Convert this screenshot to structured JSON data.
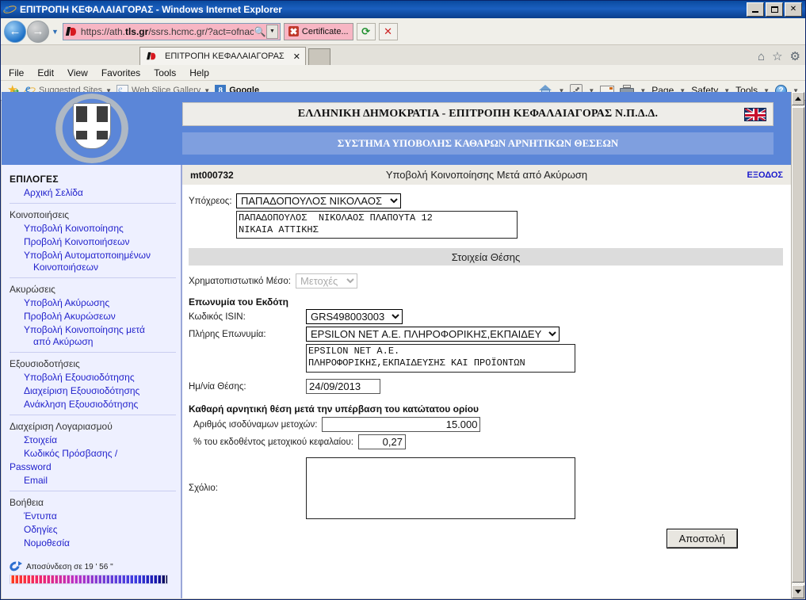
{
  "window": {
    "title": "ΕΠΙΤΡΟΠΗ ΚΕΦΑΛΑΙΑΓΟΡΑΣ - Windows Internet Explorer",
    "minimize_label": "_",
    "maximize_label": "□",
    "close_label": "✕"
  },
  "address_bar": {
    "url_prefix": "https://ath.",
    "url_domain": "tls.gr",
    "url_suffix": "/ssrs.hcmc.gr/?act=ofnac",
    "search_icon": "magnifier-icon",
    "dropdown_icon": "chevron-down-icon",
    "certificate_label": "Certificate...",
    "refresh_icon": "refresh-icon",
    "stop_icon": "stop-icon",
    "back_icon": "back-arrow-icon",
    "forward_icon": "forward-arrow-icon"
  },
  "tabs": [
    {
      "label": "ΕΠΙΤΡΟΠΗ ΚΕΦΑΛΑΙΑΓΟΡΑΣ",
      "close_label": "✕"
    }
  ],
  "tab_right_icons": [
    "home-icon",
    "favorites-star-icon",
    "tools-gear-icon"
  ],
  "menu": [
    {
      "label": "File",
      "accel": "F"
    },
    {
      "label": "Edit",
      "accel": "E"
    },
    {
      "label": "View",
      "accel": "V"
    },
    {
      "label": "Favorites",
      "accel": "a"
    },
    {
      "label": "Tools",
      "accel": "T"
    },
    {
      "label": "Help",
      "accel": "H"
    }
  ],
  "favorites_bar": {
    "add_icon": "add-to-favorites-icon",
    "items": [
      {
        "label": "Suggested Sites",
        "icon": "ie-icon",
        "has_caret": true
      },
      {
        "label": "Web Slice Gallery",
        "icon": "web-slice-icon",
        "has_caret": true
      },
      {
        "label": "Google",
        "icon": "google-icon",
        "has_caret": false
      }
    ],
    "right": [
      {
        "label": "Page",
        "icon": "page-icon"
      },
      {
        "label": "Safety",
        "icon": "safety-icon"
      },
      {
        "label": "Tools",
        "icon": "tools-icon"
      }
    ],
    "home_icon": "home-icon",
    "rss_icon": "rss-feed-icon",
    "mail_icon": "read-mail-icon",
    "print_icon": "print-icon",
    "help_icon": "help-icon"
  },
  "page_header": {
    "emblem_alt": "greek-coat-of-arms",
    "title_main": "ΕΛΛΗΝΙΚΗ ΔΗΜΟΚΡΑΤΙΑ - ΕΠΙΤΡΟΠΗ ΚΕΦΑΛΑΙΑΓΟΡΑΣ Ν.Π.Δ.Δ.",
    "title_sub": "ΣΥΣΤΗΜΑ ΥΠΟΒΟΛΗΣ ΚΑΘΑΡΩΝ ΑΡΝΗΤΙΚΩΝ ΘΕΣΕΩΝ",
    "flag_alt": "uk-flag-icon"
  },
  "sidebar": {
    "heading": "ΕΠΙΛΟΓΕΣ",
    "home_link": "Αρχική Σελίδα",
    "groups": [
      {
        "title": "Κοινοποιήσεις",
        "items": [
          {
            "label": "Υποβολή Κοινοποίησης"
          },
          {
            "label": "Προβολή Κοινοποιήσεων"
          },
          {
            "label": "Υποβολή Αυτοματοποιημένων",
            "label2": "Κοινοποιήσεων"
          }
        ]
      },
      {
        "title": "Ακυρώσεις",
        "items": [
          {
            "label": "Υποβολή Ακύρωσης"
          },
          {
            "label": "Προβολή Ακυρώσεων"
          },
          {
            "label": "Υποβολή Κοινοποίησης μετά",
            "label2": "από Ακύρωση"
          }
        ]
      },
      {
        "title": "Εξουσιοδοτήσεις",
        "items": [
          {
            "label": "Υποβολή Εξουσιοδότησης"
          },
          {
            "label": "Διαχείριση Εξουσιοδότησης"
          },
          {
            "label": "Ανάκληση Εξουσιοδότησης"
          }
        ]
      },
      {
        "title": "Διαχείριση Λογαριασμού",
        "items": [
          {
            "label": "Στοιχεία"
          },
          {
            "label": "Κωδικός Πρόσβασης /",
            "label2": "Password"
          },
          {
            "label": "Email"
          }
        ]
      },
      {
        "title": "Βοήθεια",
        "items": [
          {
            "label": "Έντυπα"
          },
          {
            "label": "Οδηγίες"
          },
          {
            "label": "Νομοθεσία"
          }
        ]
      }
    ],
    "timer": {
      "icon": "session-refresh-icon",
      "text": "Αποσύνδεση σε 19 ' 56 \""
    }
  },
  "content": {
    "form_id": "mt000732",
    "page_title": "Υποβολή Κοινοποίησης Μετά από Ακύρωση",
    "exit_label": "ΕΞΟΔΟΣ",
    "obligor": {
      "label": "Υπόχρεος:",
      "selected": "ΠΑΠΑΔΟΠΟΥΛΟΣ ΝΙΚΟΛΑΟΣ",
      "details": "ΠΑΠΑΔΟΠΟΥΛΟΣ  ΝΙΚΟΛΑΟΣ ΠΛΑΠΟΥΤΑ 12\nΝΙΚΑΙΑ ΑΤΤΙΚΗΣ"
    },
    "section_title": "Στοιχεία Θέσης",
    "instrument": {
      "label": "Χρηματοπιστωτικό Μέσο:",
      "selected": "Μετοχές"
    },
    "issuer_heading": "Επωνυμία του Εκδότη",
    "isin": {
      "label": "Κωδικός ISIN:",
      "selected": "GRS498003003"
    },
    "full_name": {
      "label": "Πλήρης Επωνυμία:",
      "selected": "EPSILON NET Α.Ε. ΠΛΗΡΟΦΟΡΙΚΗΣ,ΕΚΠΑΙΔΕΥ",
      "details": "EPSILON NET A.E.\nΠΛΗΡΟΦΟΡΙΚΗΣ,ΕΚΠΑΙΔΕΥΣΗΣ ΚΑΙ ΠΡΟΪΟΝΤΩΝ"
    },
    "position_date": {
      "label": "Ημ/νία Θέσης:",
      "value": "24/09/2013"
    },
    "net_short_heading": "Καθαρή αρνητική θέση μετά την υπέρβαση του κατώτατου ορίου",
    "equivalent_shares": {
      "label": "Αριθμός ισοδύναμων μετοχών:",
      "value": "15.000"
    },
    "percent_capital": {
      "label": "% του εκδοθέντος μετοχικού κεφαλαίου:",
      "value": "0,27"
    },
    "comment": {
      "label": "Σχόλιο:",
      "value": ""
    },
    "submit_label": "Αποστολή"
  },
  "scrollbar": {
    "up_icon": "scroll-up-arrow",
    "down_icon": "scroll-down-arrow"
  }
}
